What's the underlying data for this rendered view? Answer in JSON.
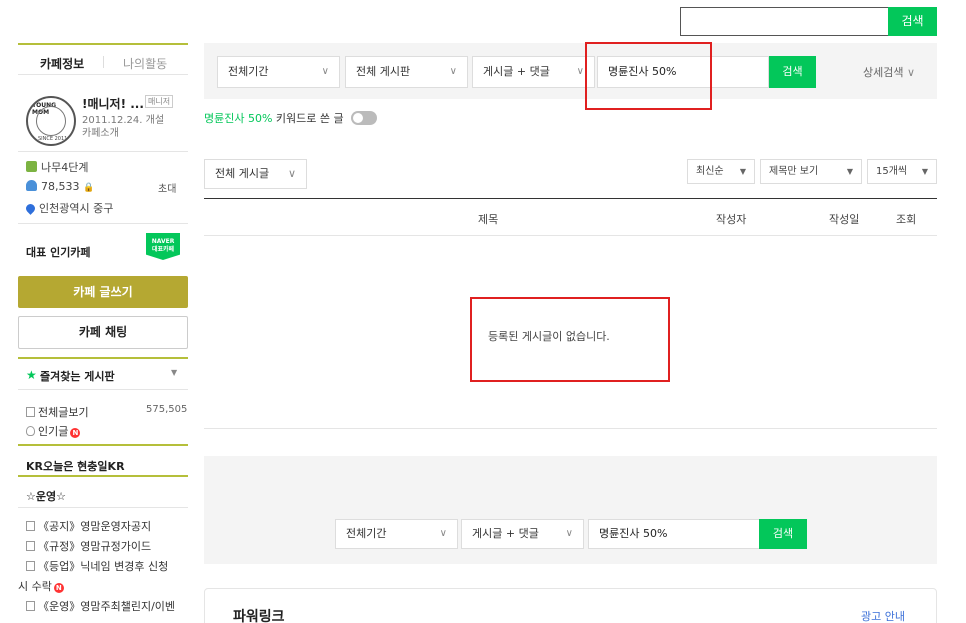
{
  "top_search": {
    "button": "검색"
  },
  "sidebar": {
    "tabs": {
      "cafe_info": "카페정보",
      "my_activity": "나의활동"
    },
    "cafe": {
      "name": "!매니저! ...",
      "manager_badge": "매니저",
      "founded": "2011.12.24. 개설",
      "intro": "카페소개",
      "level": "나무4단계",
      "members": "78,533",
      "invite": "초대",
      "location": "인천광역시 중구"
    },
    "representative": "대표 인기카페",
    "naver_badge": [
      "NAVER",
      "대표카페"
    ],
    "write_button": "카페 글쓰기",
    "chat_button": "카페 채팅",
    "favorites": "즐겨찾는 게시판",
    "all_posts": "전체글보기",
    "all_posts_count": "575,505",
    "popular": "인기글",
    "today_label": "KR오늘은 현충일KR",
    "group_ops": "☆운영☆",
    "boards": [
      "《공지》영맘운영자공지",
      "《규정》영맘규정가이드",
      "《등업》닉네임 변경후 신청",
      "시 수락",
      "《운영》영맘주최챌린지/이벤"
    ]
  },
  "filter": {
    "period": "전체기간",
    "board": "전체 게시판",
    "scope": "게시글 + 댓글",
    "query": "명륜진사 50%",
    "search_button": "검색",
    "detail_search": "상세검색"
  },
  "keyword_notice": {
    "keyword": "명륜진사 50%",
    "rest": " 키워드로 쓴 글"
  },
  "list": {
    "board_select": "전체 게시글",
    "sort": "최신순",
    "view": "제목만 보기",
    "per_page": "15개씩",
    "columns": {
      "title": "제목",
      "author": "작성자",
      "date": "작성일",
      "views": "조회"
    },
    "empty_message": "등록된 게시글이 없습니다."
  },
  "bottom_filter": {
    "period": "전체기간",
    "scope": "게시글 + 댓글",
    "query": "명륜진사 50%",
    "search_button": "검색"
  },
  "powerlink": {
    "title": "파워링크",
    "ad_info": "광고 안내"
  },
  "colors": {
    "accent_green": "#03c75a",
    "olive": "#b5a832",
    "highlight_red": "#e02020"
  }
}
